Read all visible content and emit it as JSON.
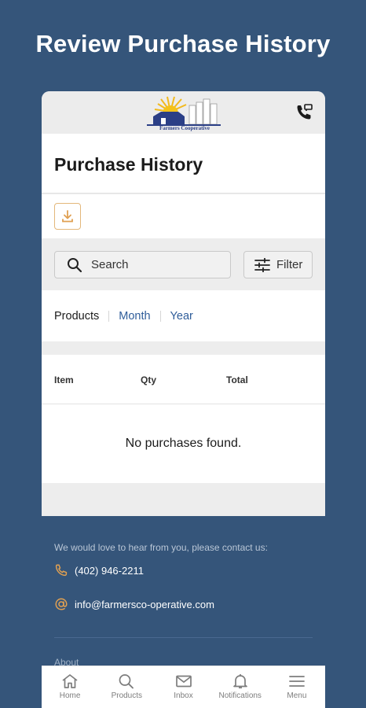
{
  "promo": {
    "title": "Review Purchase History"
  },
  "header": {
    "logo_text": "Farmers Cooperative",
    "call_icon": "phone-call-icon"
  },
  "page": {
    "title": "Purchase History",
    "export_icon": "download-icon"
  },
  "search": {
    "placeholder": "Search",
    "filter_label": "Filter"
  },
  "tabs": [
    {
      "label": "Products",
      "active": true
    },
    {
      "label": "Month",
      "active": false
    },
    {
      "label": "Year",
      "active": false
    }
  ],
  "table": {
    "columns": [
      "Item",
      "Qty",
      "Total"
    ],
    "empty_message": "No purchases found."
  },
  "footer": {
    "intro": "We would love to hear from you, please contact us:",
    "phone": "(402) 946-2211",
    "email": "info@farmersco-operative.com",
    "about": "About"
  },
  "nav": [
    {
      "label": "Home",
      "icon": "home-icon"
    },
    {
      "label": "Products",
      "icon": "search-icon"
    },
    {
      "label": "Inbox",
      "icon": "mail-icon"
    },
    {
      "label": "Notifications",
      "icon": "bell-icon"
    },
    {
      "label": "Menu",
      "icon": "menu-icon"
    }
  ],
  "colors": {
    "background": "#35557a",
    "accent_orange": "#e0a052",
    "link_blue": "#2f5d9a",
    "nav_gray": "#7d7d7d"
  }
}
